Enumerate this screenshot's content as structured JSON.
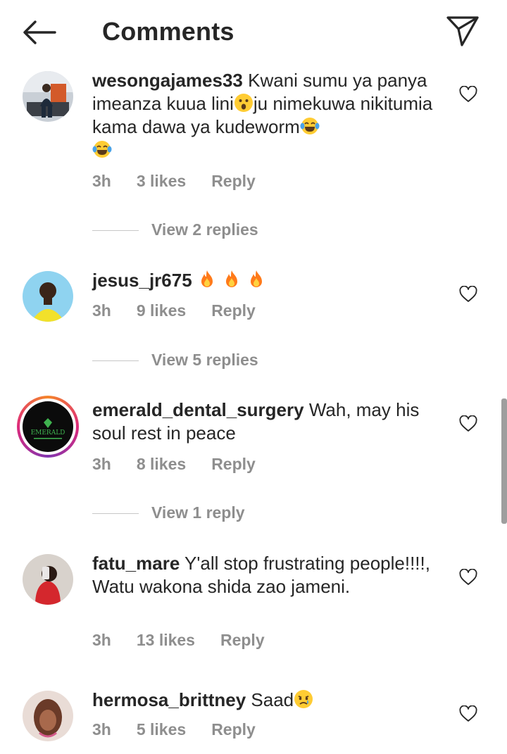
{
  "header": {
    "title": "Comments",
    "back_icon": "arrow-left-icon",
    "send_icon": "paper-plane-icon"
  },
  "comments": [
    {
      "username": "wesongajames33",
      "text_parts": [
        "Kwani sumu ya panya imeanza kuua lini",
        "ju nimekuwa nikitumia kama dawa ya kudeworm",
        ""
      ],
      "emojis": [
        "astonished-face-emoji",
        "tears-of-joy-emoji",
        "tears-of-joy-emoji"
      ],
      "time": "3h",
      "likes": "3 likes",
      "reply": "Reply",
      "view_replies": "View 2 replies"
    },
    {
      "username": "jesus_jr675",
      "emojis": [
        "fire-emoji",
        "fire-emoji",
        "fire-emoji"
      ],
      "time": "3h",
      "likes": "9 likes",
      "reply": "Reply",
      "view_replies": "View 5 replies"
    },
    {
      "username": "emerald_dental_surgery",
      "text": "Wah, may his soul rest in peace",
      "avatar_text": "EMERALD",
      "time": "3h",
      "likes": "8 likes",
      "reply": "Reply",
      "view_replies": "View 1 reply"
    },
    {
      "username": "fatu_mare",
      "text": "Y'all stop frustrating people!!!!, Watu wakona shida zao jameni.",
      "time": "3h",
      "likes": "13 likes",
      "reply": "Reply"
    },
    {
      "username": "hermosa_brittney",
      "text": "Saad",
      "emojis": [
        "crying-face-emoji"
      ],
      "time": "3h",
      "likes": "5 likes",
      "reply": "Reply"
    }
  ],
  "colors": {
    "text": "#262626",
    "secondary": "#8e8e8e",
    "divider": "#c7c7c7"
  }
}
